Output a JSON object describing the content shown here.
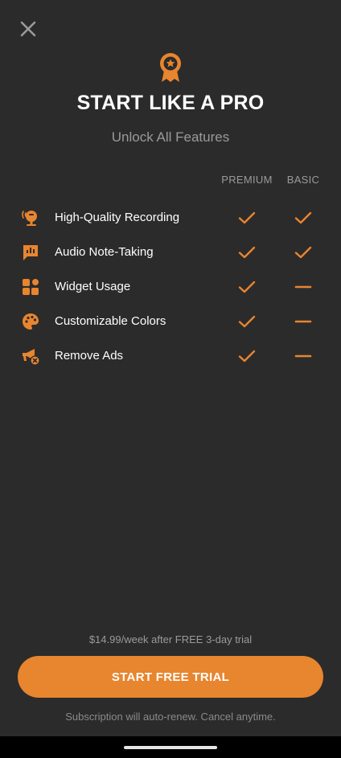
{
  "colors": {
    "background": "#2b2b2b",
    "accent": "#e8852f",
    "muted_text": "#9a9a9a",
    "primary_text": "#ffffff"
  },
  "header": {
    "close_icon": "close-icon",
    "badge_icon": "star-award-badge-icon",
    "title": "START LIKE A PRO",
    "subtitle": "Unlock All Features"
  },
  "comparison": {
    "columns": [
      "PREMIUM",
      "BASIC"
    ],
    "features": [
      {
        "label": "High-Quality Recording",
        "icon": "microphone-icon",
        "premium": "check",
        "basic": "check"
      },
      {
        "label": "Audio Note-Taking",
        "icon": "audio-note-icon",
        "premium": "check",
        "basic": "check"
      },
      {
        "label": "Widget Usage",
        "icon": "widgets-icon",
        "premium": "check",
        "basic": "dash"
      },
      {
        "label": "Customizable Colors",
        "icon": "palette-icon",
        "premium": "check",
        "basic": "dash"
      },
      {
        "label": "Remove Ads",
        "icon": "megaphone-off-icon",
        "premium": "check",
        "basic": "dash"
      }
    ]
  },
  "footer": {
    "price_note": "$14.99/week after FREE 3-day trial",
    "cta_label": "START FREE TRIAL",
    "renew_note": "Subscription will auto-renew. Cancel anytime."
  }
}
